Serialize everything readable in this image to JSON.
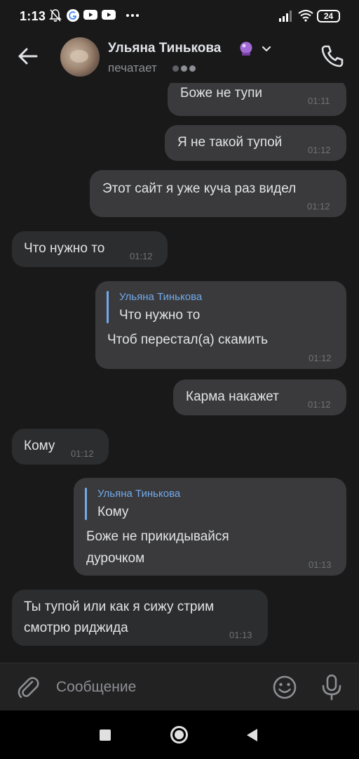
{
  "status_bar": {
    "time": "1:13",
    "battery": "24",
    "icons": [
      "mute-bell-icon",
      "google-icon",
      "youtube-icon",
      "youtube-icon",
      "more-dots-icon",
      "signal-icon",
      "wifi-icon",
      "battery-icon"
    ]
  },
  "header": {
    "contact_name": "Ульяна Тинькова",
    "status": "печатает",
    "icons": [
      "back-arrow-icon",
      "crystal-ball-emoji",
      "chevron-down-icon",
      "phone-icon"
    ]
  },
  "messages": [
    {
      "direction": "out",
      "text": "Боже не тупи",
      "time": "01:11"
    },
    {
      "direction": "out",
      "text": "Я не такой тупой",
      "time": "01:12"
    },
    {
      "direction": "out",
      "text": "Этот сайт я уже куча раз видел",
      "time": "01:12"
    },
    {
      "direction": "in",
      "text": "Что нужно то",
      "time": "01:12"
    },
    {
      "direction": "out",
      "reply": {
        "name": "Ульяна Тинькова",
        "text": "Что нужно то"
      },
      "text": "Чтоб перестал(а) скамить",
      "time": "01:12"
    },
    {
      "direction": "out",
      "text": "Карма накажет",
      "time": "01:12"
    },
    {
      "direction": "in",
      "text": "Кому",
      "time": "01:12"
    },
    {
      "direction": "out",
      "reply": {
        "name": "Ульяна Тинькова",
        "text": "Кому"
      },
      "text_lines": [
        "Боже не прикидывайся",
        "дурочком"
      ],
      "time": "01:13"
    },
    {
      "direction": "in",
      "text_lines": [
        "Ты тупой или как я сижу стрим",
        "смотрю риджида"
      ],
      "time": "01:13"
    }
  ],
  "composer": {
    "placeholder": "Сообщение",
    "icons": [
      "paperclip-icon",
      "emoji-icon",
      "microphone-icon"
    ]
  },
  "colors": {
    "background": "#19191a",
    "bubble_out": "#3a3a3c",
    "bubble_in": "#2c2d2e",
    "accent": "#71aaeb",
    "text": "#e1e3e6",
    "secondary_text": "#8d8f94"
  }
}
